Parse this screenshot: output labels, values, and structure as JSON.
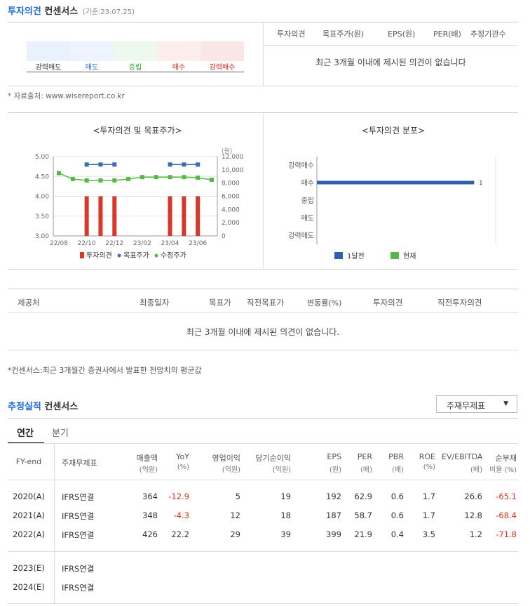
{
  "consensus": {
    "title_blue": "투자의견",
    "title_black": "컨센서스",
    "date": "(기준:23.07.25)",
    "scale_labels": [
      "강력매도",
      "매도",
      "중립",
      "매수",
      "강력매수"
    ],
    "table_headers": [
      "투자의견",
      "목표주가(원)",
      "EPS(원)",
      "PER(배)",
      "추정기관수"
    ],
    "empty_msg": "최근 3개월 이내에 제시된 의견이 없습니다",
    "source": "* 자료출처: www.wisereport.co.kr"
  },
  "chart_left": {
    "title": "<투자의견 및 목표주가>",
    "unit": "(원)",
    "legend": [
      "투자의견",
      "목표주가",
      "수정주가"
    ]
  },
  "chart_right": {
    "title": "<투자의견 분포>",
    "legend": [
      "1달전",
      "현재"
    ]
  },
  "chart_data": [
    {
      "type": "bar+line",
      "title": "<투자의견 및 목표주가>",
      "x_labels": [
        "22/08",
        "22/10",
        "22/12",
        "23/02",
        "23/04",
        "23/06"
      ],
      "y_left_ticks": [
        "5.00",
        "4.50",
        "4.00",
        "3.50",
        "3.00"
      ],
      "y_right_ticks": [
        "12,000",
        "10,000",
        "8,000",
        "6,000",
        "4,000",
        "2,000",
        "0"
      ],
      "ylim_left": [
        3,
        5
      ],
      "ylim_right": [
        0,
        12000
      ],
      "series": [
        {
          "name": "투자의견",
          "type": "bar",
          "x": [
            2,
            3,
            4,
            8,
            9,
            10
          ],
          "values": [
            4,
            4,
            4,
            4,
            4,
            4
          ]
        },
        {
          "name": "목표주가",
          "type": "line",
          "x": [
            2,
            3,
            4,
            8,
            9,
            10
          ],
          "values": [
            4.8,
            4.8,
            4.8,
            4.8,
            4.8,
            4.8
          ]
        },
        {
          "name": "수정주가",
          "type": "line",
          "x": [
            0,
            1,
            2,
            3,
            4,
            5,
            6,
            7,
            8,
            9,
            10,
            11
          ],
          "values": [
            9500,
            8600,
            8400,
            8400,
            8400,
            8600,
            8900,
            8900,
            8900,
            8900,
            8800,
            8500
          ]
        }
      ]
    },
    {
      "type": "bar",
      "title": "<투자의견 분포>",
      "categories": [
        "강력매수",
        "매수",
        "중립",
        "매도",
        "강력매도"
      ],
      "series": [
        {
          "name": "1달전",
          "values": [
            0,
            1,
            0,
            0,
            0
          ]
        },
        {
          "name": "현재",
          "values": [
            0,
            0,
            0,
            0,
            0
          ]
        }
      ],
      "data_labels": [
        "1"
      ]
    }
  ],
  "provider_table": {
    "headers": [
      "제공처",
      "최종일자",
      "목표가",
      "직전목표가",
      "변동률(%)",
      "투자의견",
      "직전투자의견"
    ],
    "empty_msg": "최근 3개월 이내에 제시된 의견이 없습니다.",
    "note": "*컨센서스:최근 3개월간 증권사에서 발표한 전망치의 평균값"
  },
  "estimate": {
    "title_blue": "추정실적",
    "title_black": "컨센서스",
    "select_value": "주재무제표",
    "select_arrow": "▼",
    "tabs": [
      "연간",
      "분기"
    ],
    "headers": [
      [
        "FY-end",
        ""
      ],
      [
        "주재무제표",
        ""
      ],
      [
        "매출액",
        "(억원)"
      ],
      [
        "YoY",
        "(%)"
      ],
      [
        "영업이익",
        "(억원)"
      ],
      [
        "당기순이익",
        "(억원)"
      ],
      [
        "EPS",
        "(원)"
      ],
      [
        "PER",
        "(배)"
      ],
      [
        "PBR",
        "(배)"
      ],
      [
        "ROE",
        "(%)"
      ],
      [
        "EV/EBITDA",
        "(배)"
      ],
      [
        "순부채",
        "비율 (%)"
      ]
    ],
    "rows": [
      [
        "2020(A)",
        "IFRS연결",
        "364",
        "-12.9",
        "5",
        "19",
        "192",
        "62.9",
        "0.6",
        "1.7",
        "26.6",
        "-65.1"
      ],
      [
        "2021(A)",
        "IFRS연결",
        "348",
        "-4.3",
        "12",
        "18",
        "187",
        "58.7",
        "0.6",
        "1.7",
        "12.8",
        "-68.4"
      ],
      [
        "2022(A)",
        "IFRS연결",
        "426",
        "22.2",
        "29",
        "39",
        "399",
        "21.9",
        "0.4",
        "3.5",
        "1.2",
        "-71.8"
      ],
      [
        "2023(E)",
        "IFRS연결",
        "",
        "",
        "",
        "",
        "",
        "",
        "",
        "",
        "",
        ""
      ],
      [
        "2024(E)",
        "IFRS연결",
        "",
        "",
        "",
        "",
        "",
        "",
        "",
        "",
        "",
        ""
      ]
    ]
  },
  "colors": {
    "accent": "#1f6bd6",
    "bar_red": "#d9372a",
    "line_blue": "#3d6bb5",
    "line_green": "#57b847",
    "bar_dist": "#2f5fb3",
    "negative": "#e0301e"
  }
}
